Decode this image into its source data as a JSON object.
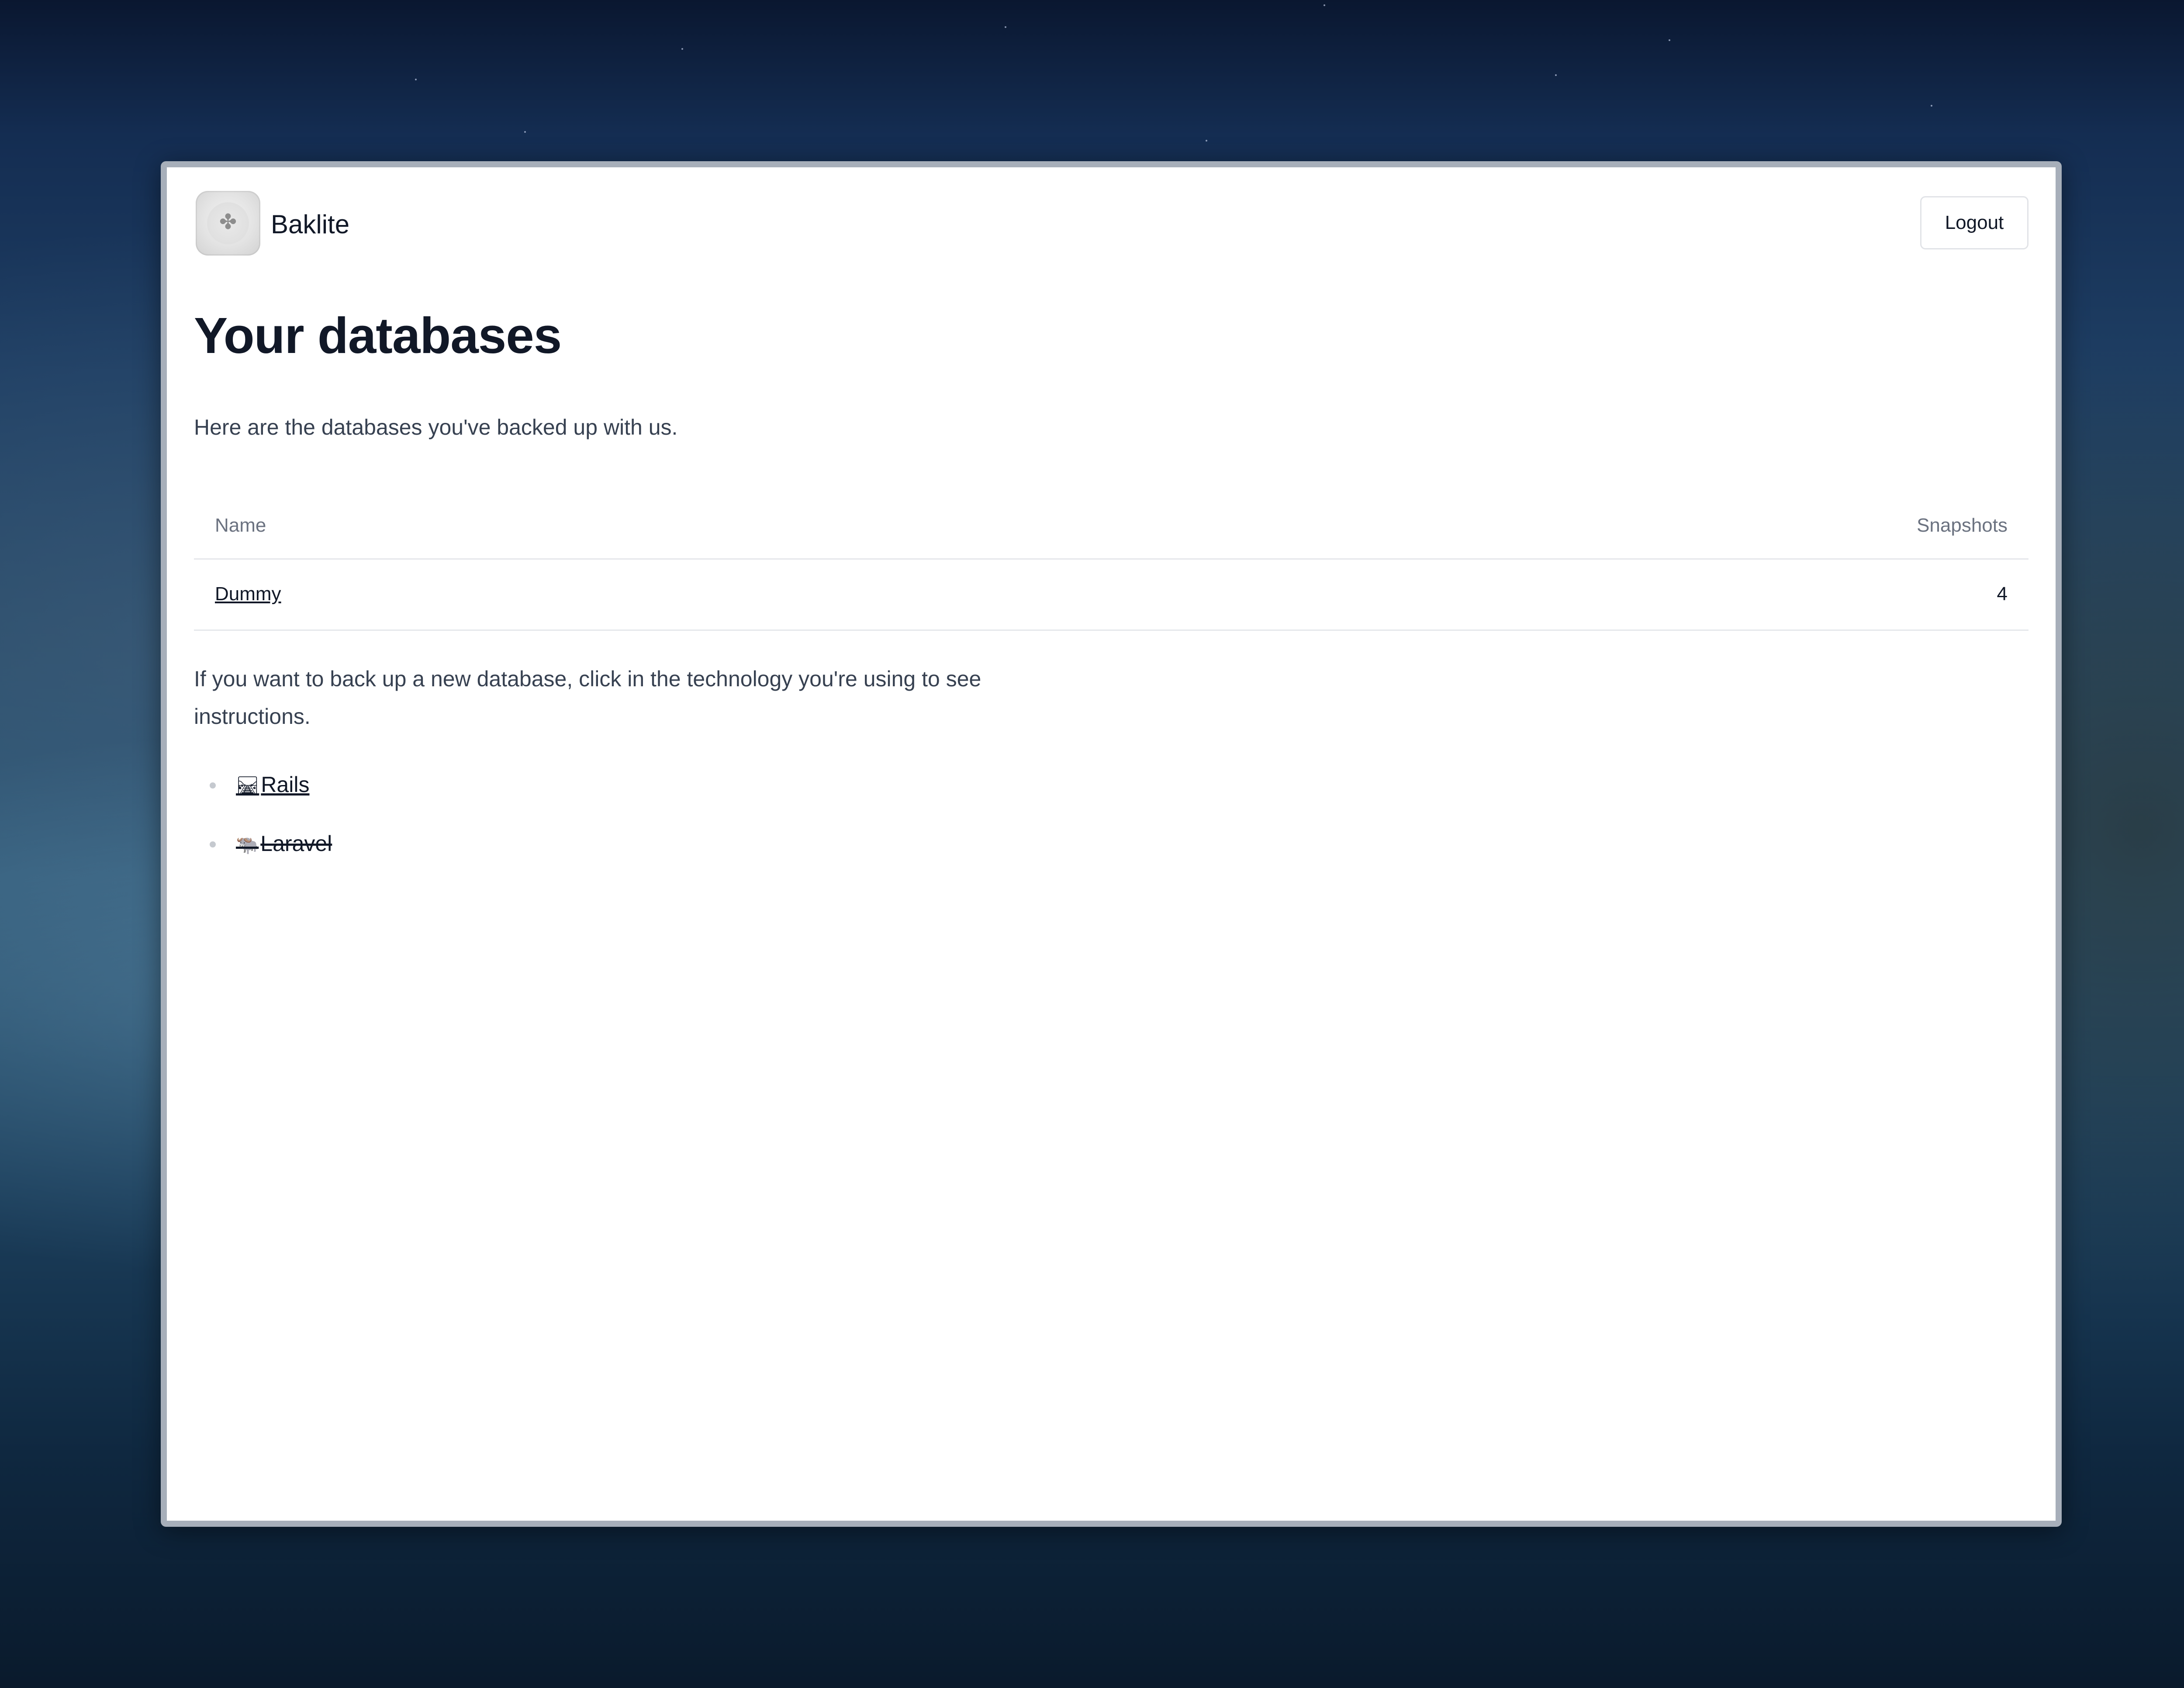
{
  "app": {
    "name": "Baklite",
    "logout_label": "Logout"
  },
  "page": {
    "title": "Your databases",
    "intro": "Here are the databases you've backed up with us.",
    "help_text": "If you want to back up a new database, click in the technology you're using to see instructions."
  },
  "table": {
    "columns": [
      "Name",
      "Snapshots"
    ],
    "rows": [
      {
        "name": "Dummy",
        "snapshots": "4"
      }
    ]
  },
  "technologies": [
    {
      "icon": "🛤",
      "label": "Rails",
      "disabled": false
    },
    {
      "icon": "🐃",
      "label": "Laravel",
      "disabled": true
    }
  ]
}
